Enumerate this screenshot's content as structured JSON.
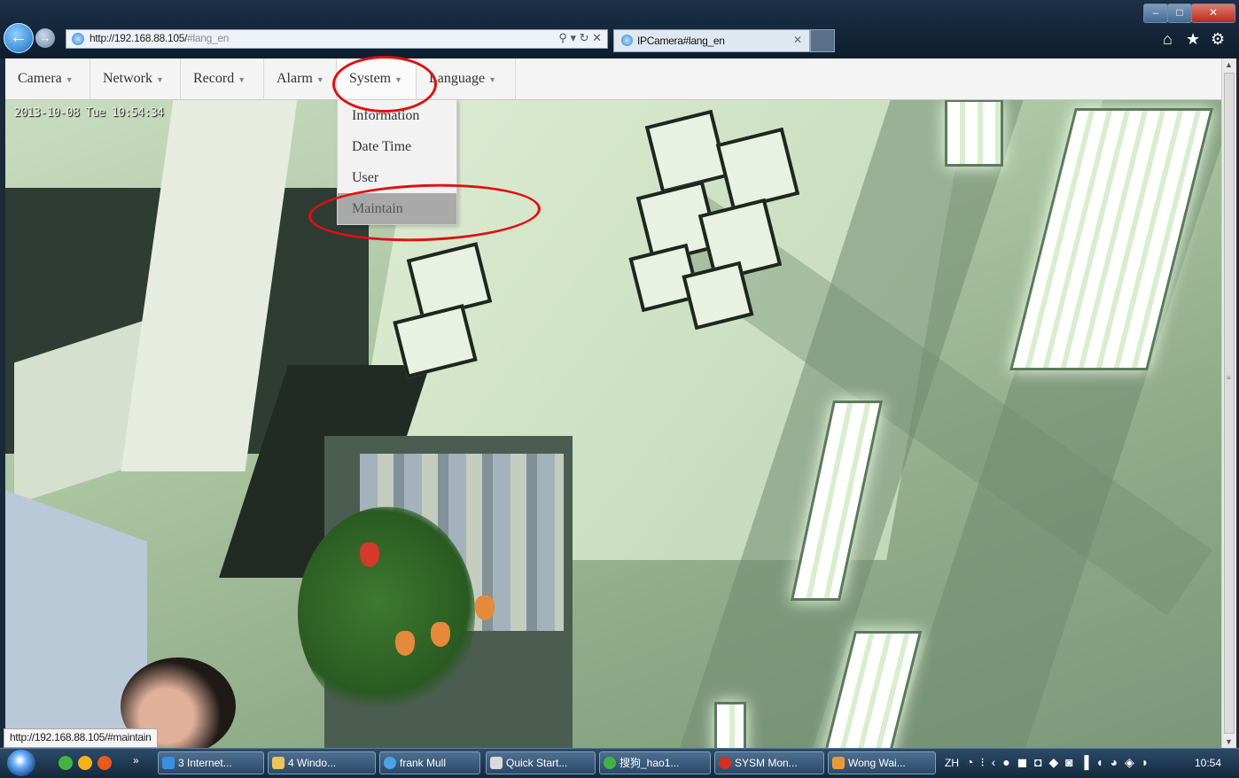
{
  "browser": {
    "address": {
      "url_main": "http://192.168.88.105/",
      "url_hash": "#lang_en",
      "tools": "⚲ ▾ ↻ ✕"
    },
    "tab": {
      "title": "IPCamera#lang_en",
      "close": "✕"
    },
    "window_controls": {
      "minimize": "–",
      "maximize": "□",
      "close": "✕"
    },
    "toolbar_icons": [
      "home-icon",
      "star-icon",
      "gear-icon"
    ]
  },
  "menubar": {
    "items": [
      {
        "label": "Camera"
      },
      {
        "label": "Network"
      },
      {
        "label": "Record"
      },
      {
        "label": "Alarm"
      },
      {
        "label": "System"
      },
      {
        "label": "Language"
      }
    ],
    "caret": "▼"
  },
  "dropdown": {
    "items": [
      {
        "label": "Information"
      },
      {
        "label": "Date Time"
      },
      {
        "label": "User"
      },
      {
        "label": "Maintain",
        "state": "hover"
      }
    ]
  },
  "camera": {
    "osd_timestamp": "2013-10-08 Tue 10:54:34"
  },
  "status_bar": {
    "url": "http://192.168.88.105/#maintain"
  },
  "taskbar": {
    "more": "»",
    "tasks": [
      {
        "label": "3 Internet..."
      },
      {
        "label": "4 Windo..."
      },
      {
        "label": "frank Mull"
      },
      {
        "label": "Quick Start..."
      },
      {
        "label": "搜狗_hao1..."
      },
      {
        "label": "SYSM Mon..."
      },
      {
        "label": "Wong Wai..."
      }
    ],
    "tray": {
      "language": "ZH",
      "clock": "10:54"
    }
  },
  "colors": {
    "annotation": "#e01010",
    "menu_hover": "#a9a9a9",
    "chrome_bg": "#1c3047"
  }
}
